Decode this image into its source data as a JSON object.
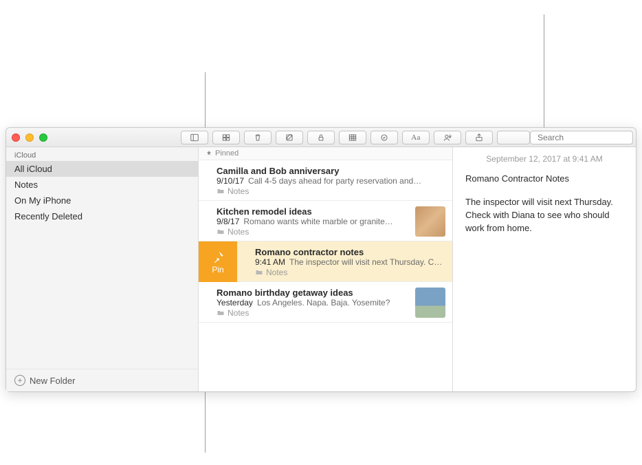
{
  "sidebar": {
    "section_label": "iCloud",
    "items": [
      {
        "label": "All iCloud",
        "selected": true
      },
      {
        "label": "Notes"
      },
      {
        "label": "On My iPhone"
      },
      {
        "label": "Recently Deleted"
      }
    ],
    "new_folder_label": "New Folder"
  },
  "pinned_header": "Pinned",
  "pin_action_label": "Pin",
  "notes": [
    {
      "title": "Camilla and Bob anniversary",
      "date": "9/10/17",
      "preview": "Call 4-5 days ahead for party reservation and…",
      "folder": "Notes",
      "selected": false,
      "thumb": null,
      "reveal_pin": false
    },
    {
      "title": "Kitchen remodel ideas",
      "date": "9/8/17",
      "preview": "Romano wants white marble or granite…",
      "folder": "Notes",
      "selected": false,
      "thumb": "wood",
      "reveal_pin": false
    },
    {
      "title": "Romano contractor notes",
      "date": "9:41 AM",
      "preview": "The inspector will visit next Thursday. Check",
      "folder": "Notes",
      "selected": true,
      "thumb": null,
      "reveal_pin": true
    },
    {
      "title": "Romano birthday getaway ideas",
      "date": "Yesterday",
      "preview": "Los Angeles. Napa. Baja. Yosemite?",
      "folder": "Notes",
      "selected": false,
      "thumb": "photo",
      "reveal_pin": false
    }
  ],
  "editor": {
    "timestamp": "September 12, 2017 at 9:41 AM",
    "title": "Romano Contractor Notes",
    "body": "The inspector will visit next Thursday. Check with Diana to see who should work from home."
  },
  "search_placeholder": "Search"
}
